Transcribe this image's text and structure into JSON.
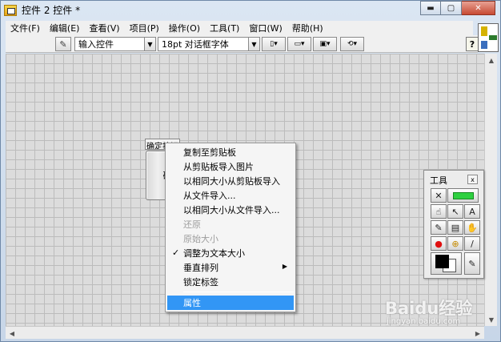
{
  "window": {
    "title": "控件 2 控件 *",
    "caption_minimize": "▬",
    "caption_maximize": "▢",
    "caption_close": "✕"
  },
  "menubar": {
    "items": [
      "文件(F)",
      "编辑(E)",
      "查看(V)",
      "项目(P)",
      "操作(O)",
      "工具(T)",
      "窗口(W)",
      "帮助(H)"
    ]
  },
  "toolbar": {
    "edit_icon": "pencil-icon",
    "control_type": "输入控件",
    "font": "18pt 对话框字体",
    "help": "?"
  },
  "front_panel": {
    "control_label": "确定按钮",
    "button_text": "确"
  },
  "context_menu": {
    "items": [
      {
        "label": "复制至剪贴板",
        "enabled": true
      },
      {
        "label": "从剪贴板导入图片",
        "enabled": true
      },
      {
        "label": "以相同大小从剪贴板导入",
        "enabled": true
      },
      {
        "label": "从文件导入...",
        "enabled": true
      },
      {
        "label": "以相同大小从文件导入...",
        "enabled": true
      },
      {
        "label": "还原",
        "enabled": false
      },
      {
        "label": "原始大小",
        "enabled": false
      },
      {
        "label": "调整为文本大小",
        "enabled": true,
        "checked": true,
        "check_mark": "✓"
      },
      {
        "label": "垂直排列",
        "enabled": true,
        "submenu": true,
        "submenu_mark": "▶"
      },
      {
        "label": "锁定标签",
        "enabled": true
      },
      {
        "label": "属性",
        "enabled": true,
        "highlighted": true
      }
    ],
    "highlight_color": "#3296f5"
  },
  "tools_palette": {
    "title": "工具",
    "close": "x",
    "tools": [
      "automatic-tool",
      "operate-value-tool",
      "position-select-tool",
      "edit-text-tool",
      "connect-wire-tool",
      "object-shortcut-menu-tool",
      "scroll-window-tool",
      "set-clear-breakpoint-tool",
      "probe-data-tool",
      "get-color-tool",
      "set-color-tool"
    ]
  },
  "watermark": {
    "main": "Baidu经验",
    "sub": "jingyan.baidu.com"
  }
}
